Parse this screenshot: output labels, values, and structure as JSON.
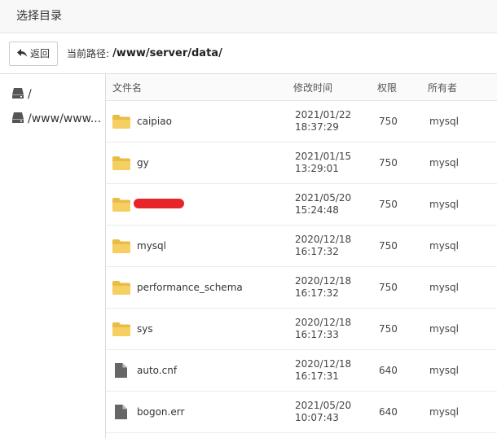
{
  "dialog": {
    "title": "选择目录"
  },
  "toolbar": {
    "back_label": "返回",
    "path_label": "当前路径:",
    "path_value": "/www/server/data/"
  },
  "sidebar": {
    "drives": [
      {
        "label": "/"
      },
      {
        "label": "/www/www..."
      }
    ]
  },
  "table": {
    "headers": {
      "name": "文件名",
      "time": "修改时间",
      "perm": "权限",
      "owner": "所有者"
    },
    "rows": [
      {
        "type": "folder",
        "name": "caipiao",
        "date": "2021/01/22",
        "time": "18:37:29",
        "perm": "750",
        "owner": "mysql"
      },
      {
        "type": "folder",
        "name": "gy",
        "date": "2021/01/15",
        "time": "13:29:01",
        "perm": "750",
        "owner": "mysql"
      },
      {
        "type": "folder",
        "name": "",
        "redacted": true,
        "date": "2021/05/20",
        "time": "15:24:48",
        "perm": "750",
        "owner": "mysql"
      },
      {
        "type": "folder",
        "name": "mysql",
        "date": "2020/12/18",
        "time": "16:17:32",
        "perm": "750",
        "owner": "mysql"
      },
      {
        "type": "folder",
        "name": "performance_schema",
        "date": "2020/12/18",
        "time": "16:17:32",
        "perm": "750",
        "owner": "mysql"
      },
      {
        "type": "folder",
        "name": "sys",
        "date": "2020/12/18",
        "time": "16:17:33",
        "perm": "750",
        "owner": "mysql"
      },
      {
        "type": "file",
        "name": "auto.cnf",
        "date": "2020/12/18",
        "time": "16:17:31",
        "perm": "640",
        "owner": "mysql"
      },
      {
        "type": "file",
        "name": "bogon.err",
        "date": "2021/05/20",
        "time": "10:07:43",
        "perm": "640",
        "owner": "mysql"
      }
    ]
  },
  "colors": {
    "folder": "#f5cf62",
    "folder_dark": "#e9bd45",
    "file": "#666666",
    "redaction": "#e8242b"
  },
  "icons": {
    "back": "arrow-left-icon",
    "drive": "hard-drive-icon",
    "folder": "folder-icon",
    "file": "file-icon"
  }
}
